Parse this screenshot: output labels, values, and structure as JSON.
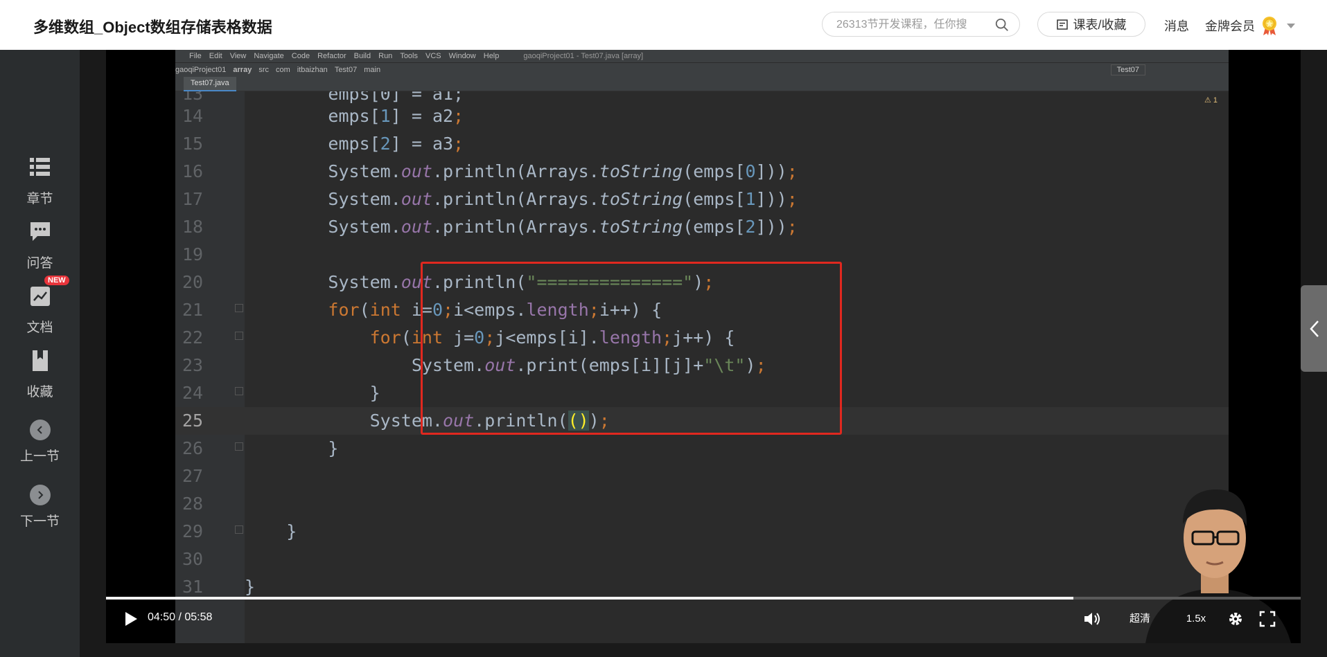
{
  "header": {
    "title": "多维数组_Object数组存储表格数据",
    "search_placeholder": "26313节开发课程，任你搜",
    "schedule_label": "课表/收藏",
    "messages_label": "消息",
    "vip_label": "金牌会员"
  },
  "sidebar": {
    "items": [
      {
        "label": "章节",
        "icon": "chapter-list-icon"
      },
      {
        "label": "问答",
        "icon": "chat-icon"
      },
      {
        "label": "文档",
        "icon": "document-chart-icon",
        "badge": "NEW"
      },
      {
        "label": "收藏",
        "icon": "bookmark-icon"
      },
      {
        "label": "上一节",
        "icon": "chevron-left-icon"
      },
      {
        "label": "下一节",
        "icon": "chevron-right-icon"
      }
    ]
  },
  "ide": {
    "menu": [
      "File",
      "Edit",
      "View",
      "Navigate",
      "Code",
      "Refactor",
      "Build",
      "Run",
      "Tools",
      "VCS",
      "Window",
      "Help"
    ],
    "window_title": "gaoqiProject01 - Test07.java [array]",
    "breadcrumbs": [
      "gaoqiProject01",
      "array",
      "src",
      "com",
      "itbaizhan",
      "Test07",
      "main"
    ],
    "file_tab": "Test07.java",
    "run_config": "Test07",
    "warning": "⚠ 1",
    "current_line": "25"
  },
  "player": {
    "time": "04:50 / 05:58",
    "progress": 0.81,
    "quality_label": "超清",
    "speed_label": "1.5x"
  },
  "colors": {
    "brand_red": "#e0281f",
    "badge_red": "#e8343b",
    "ide_bg": "#2b2b2b"
  }
}
